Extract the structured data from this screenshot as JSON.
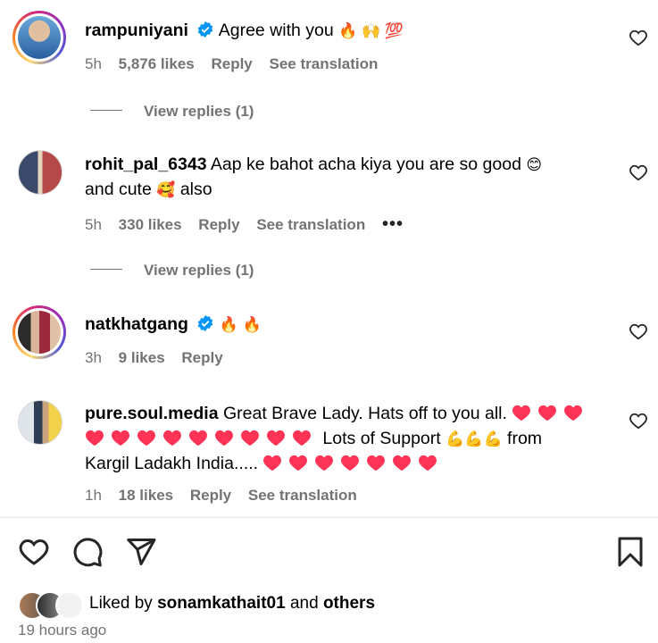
{
  "comments": [
    {
      "username": "rampuniyani",
      "verified": true,
      "text": "Agree with you",
      "emojis": "🔥 🙌 💯",
      "time": "5h",
      "likes": "5,876 likes",
      "reply": "Reply",
      "translate": "See translation",
      "view_replies": "View replies (1)"
    },
    {
      "username": "rohit_pal_6343",
      "text_line1": "Aap ke bahot acha kiya you are so good",
      "emoji1": "😊",
      "text_line2a": "and cute",
      "emoji2": "🥰",
      "text_line2b": "also",
      "time": "5h",
      "likes": "330 likes",
      "reply": "Reply",
      "translate": "See translation",
      "more": "•••",
      "view_replies": "View replies (1)"
    },
    {
      "username": "natkhatgang",
      "verified": true,
      "emojis": "🔥 🔥",
      "time": "3h",
      "likes": "9 likes",
      "reply": "Reply"
    },
    {
      "username": "pure.soul.media",
      "text_a": "Great Brave Lady. Hats off to you all.",
      "text_b": "Lots of Support",
      "text_c": "from",
      "text_d": "Kargil Ladakh India.....",
      "muscle": "💪",
      "time": "1h",
      "likes": "18 likes",
      "reply": "Reply",
      "translate": "See translation"
    }
  ],
  "footer": {
    "liked_by_prefix": "Liked by",
    "liked_by_user": "sonamkathait01",
    "liked_by_and": "and",
    "liked_by_others": "others",
    "timestamp": "19 hours ago"
  },
  "colors": {
    "verified": "#0095f6",
    "heart": "#ff3355",
    "muted": "#737373"
  }
}
